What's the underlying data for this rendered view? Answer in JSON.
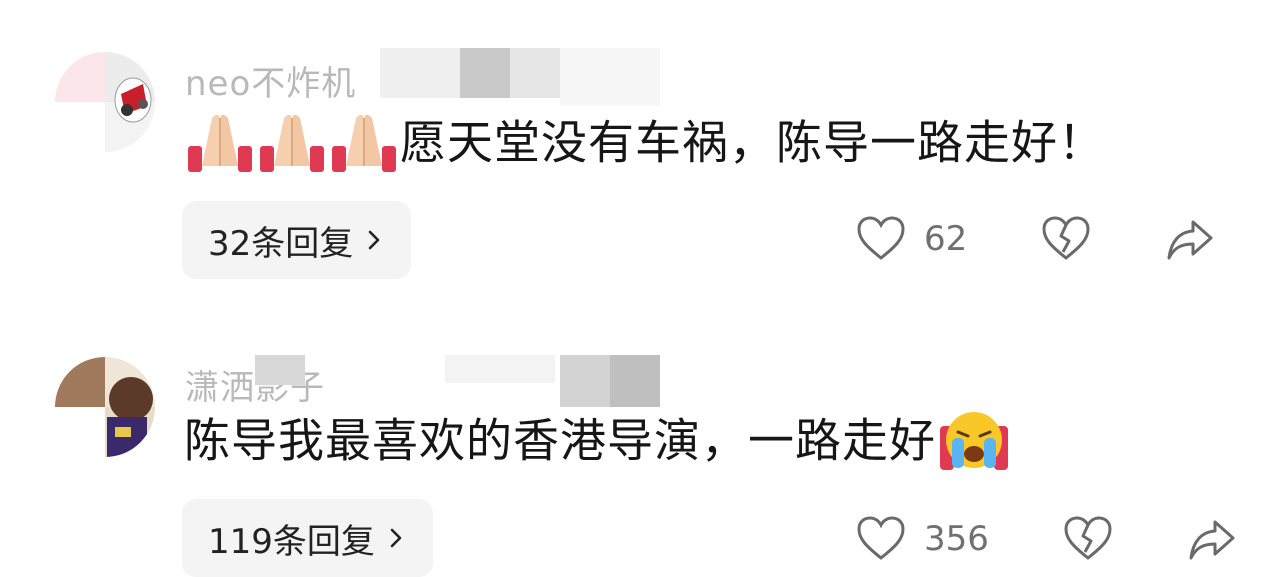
{
  "comments": [
    {
      "username": "neo不炸机",
      "text": "愿天堂没有车祸，陈导一路走好！",
      "replies_label": "32条回复",
      "likes": "62",
      "emoji_before": [
        "folded-hands-icon",
        "folded-hands-icon",
        "folded-hands-icon"
      ],
      "emoji_after": []
    },
    {
      "username": "潇洒影子",
      "text": "陈导我最喜欢的香港导演，一路走好",
      "replies_label": "119条回复",
      "likes": "356",
      "emoji_before": [],
      "emoji_after": [
        "loudly-crying-face-icon"
      ]
    }
  ],
  "colors": {
    "text": "#161616",
    "muted": "#b9b9b9",
    "count": "#707070",
    "button_bg": "#f4f4f4"
  }
}
